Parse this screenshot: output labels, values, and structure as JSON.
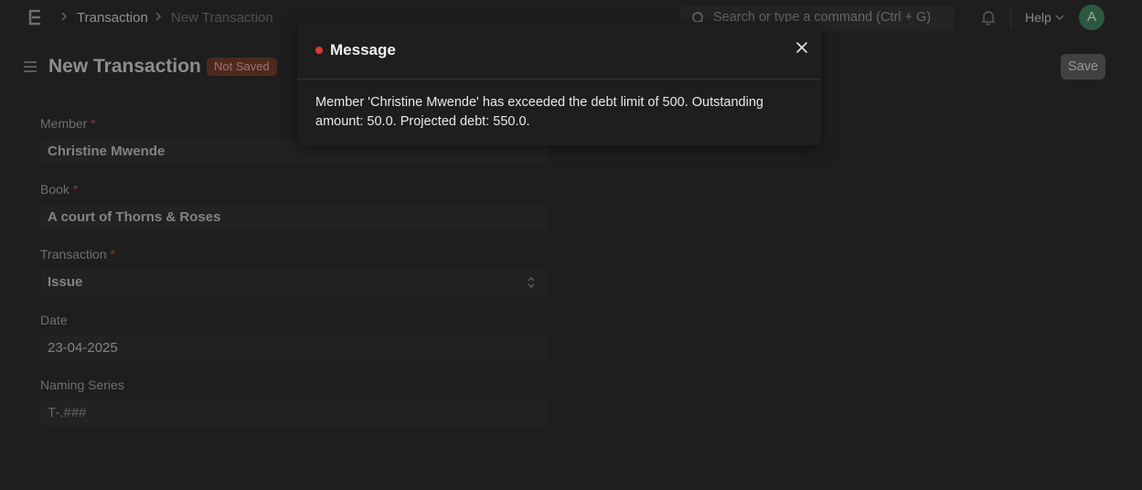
{
  "breadcrumbs": [
    "Transaction",
    "New Transaction"
  ],
  "search": {
    "placeholder": "Search or type a command (Ctrl + G)"
  },
  "navbar": {
    "help_label": "Help",
    "avatar_initial": "A"
  },
  "page": {
    "title": "New Transaction",
    "status": "Not Saved",
    "save_label": "Save"
  },
  "form": {
    "member": {
      "label": "Member",
      "required": "*",
      "value": "Christine Mwende"
    },
    "book": {
      "label": "Book",
      "required": "*",
      "value": "A court of Thorns & Roses"
    },
    "transaction": {
      "label": "Transaction",
      "required": "*",
      "value": "Issue"
    },
    "date": {
      "label": "Date",
      "value": "23-04-2025"
    },
    "naming_series": {
      "label": "Naming Series",
      "value": "T-.###"
    }
  },
  "modal": {
    "title": "Message",
    "indicator_color": "#e03636",
    "body": "Member 'Christine Mwende' has exceeded the debt limit of 500. Outstanding amount: 50.0. Projected debt: 550.0."
  },
  "icons": [
    "app-logo-icon",
    "chevron-right-icon",
    "search-icon",
    "bell-icon",
    "chevron-down-icon",
    "hamburger-icon",
    "select-arrows-icon",
    "close-icon"
  ]
}
